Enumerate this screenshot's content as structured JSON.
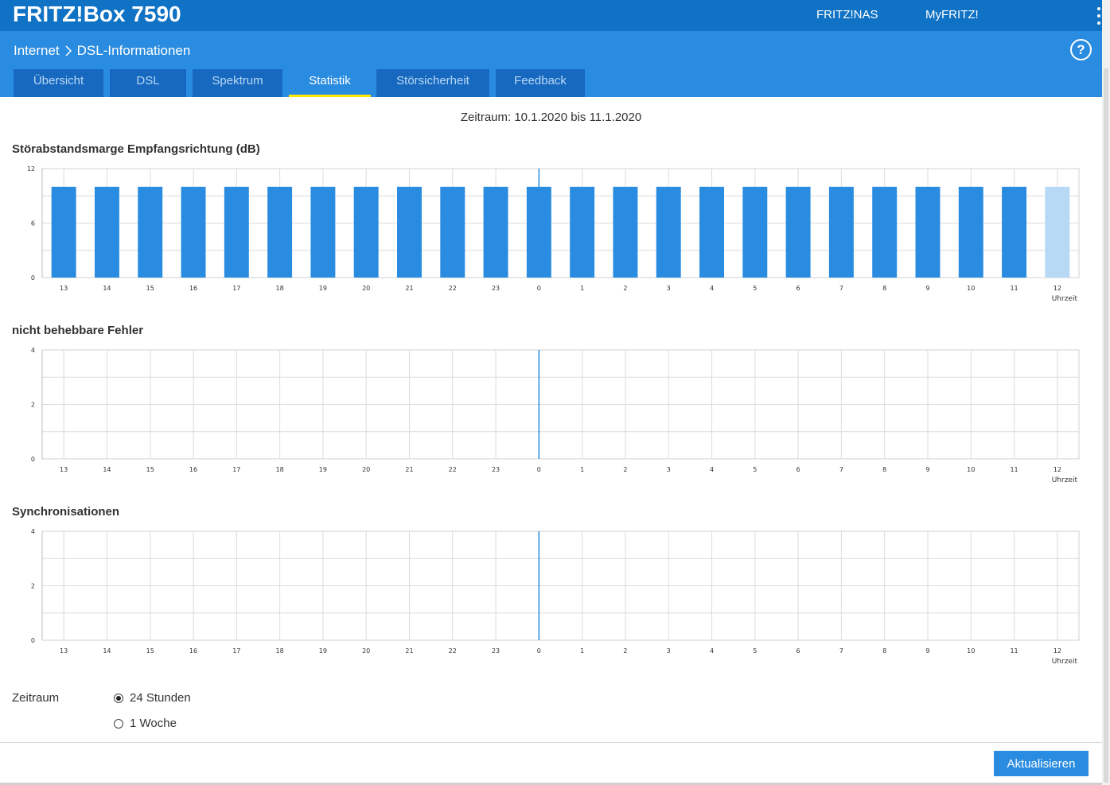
{
  "header": {
    "brand": "FRITZ!Box 7590",
    "links": [
      "FRITZ!NAS",
      "MyFRITZ!"
    ]
  },
  "breadcrumb": {
    "parent": "Internet",
    "separator": ">",
    "current": "DSL-Informationen"
  },
  "tabs": [
    {
      "label": "Übersicht",
      "active": false
    },
    {
      "label": "DSL",
      "active": false
    },
    {
      "label": "Spektrum",
      "active": false
    },
    {
      "label": "Statistik",
      "active": true
    },
    {
      "label": "Störsicherheit",
      "active": false
    },
    {
      "label": "Feedback",
      "active": false
    }
  ],
  "period_text": "Zeitraum: 10.1.2020 bis 11.1.2020",
  "colors": {
    "accent": "#2a8ce0",
    "header": "#0f72c4",
    "tab_inactive": "#1769c0",
    "tab_active_underline": "#ffe600",
    "bar": "#2a8ce0",
    "bar_current": "#b8d9f5"
  },
  "chart_data": [
    {
      "type": "bar",
      "title": "Störabstandsmarge Empfangsrichtung (dB)",
      "xlabel": "Uhrzeit",
      "categories": [
        "13",
        "14",
        "15",
        "16",
        "17",
        "18",
        "19",
        "20",
        "21",
        "22",
        "23",
        "0",
        "1",
        "2",
        "3",
        "4",
        "5",
        "6",
        "7",
        "8",
        "9",
        "10",
        "11",
        "12"
      ],
      "values": [
        10,
        10,
        10,
        10,
        10,
        10,
        10,
        10,
        10,
        10,
        10,
        10,
        10,
        10,
        10,
        10,
        10,
        10,
        10,
        10,
        10,
        10,
        10,
        10
      ],
      "partial_last": true,
      "ylim": [
        0,
        12
      ],
      "yticks": [
        0,
        6,
        12
      ],
      "midnight_marker": "0",
      "grid": true
    },
    {
      "type": "bar",
      "title": "nicht behebbare Fehler",
      "xlabel": "Uhrzeit",
      "categories": [
        "13",
        "14",
        "15",
        "16",
        "17",
        "18",
        "19",
        "20",
        "21",
        "22",
        "23",
        "0",
        "1",
        "2",
        "3",
        "4",
        "5",
        "6",
        "7",
        "8",
        "9",
        "10",
        "11",
        "12"
      ],
      "values": [
        0,
        0,
        0,
        0,
        0,
        0,
        0,
        0,
        0,
        0,
        0,
        0,
        0,
        0,
        0,
        0,
        0,
        0,
        0,
        0,
        0,
        0,
        0,
        0
      ],
      "ylim": [
        0,
        4
      ],
      "yticks": [
        0,
        2,
        4
      ],
      "midnight_marker": "0",
      "grid": true
    },
    {
      "type": "bar",
      "title": "Synchronisationen",
      "xlabel": "Uhrzeit",
      "categories": [
        "13",
        "14",
        "15",
        "16",
        "17",
        "18",
        "19",
        "20",
        "21",
        "22",
        "23",
        "0",
        "1",
        "2",
        "3",
        "4",
        "5",
        "6",
        "7",
        "8",
        "9",
        "10",
        "11",
        "12"
      ],
      "values": [
        0,
        0,
        0,
        0,
        0,
        0,
        0,
        0,
        0,
        0,
        0,
        0,
        0,
        0,
        0,
        0,
        0,
        0,
        0,
        0,
        0,
        0,
        0,
        0
      ],
      "ylim": [
        0,
        4
      ],
      "yticks": [
        0,
        2,
        4
      ],
      "midnight_marker": "0",
      "grid": true
    }
  ],
  "form": {
    "label": "Zeitraum",
    "options": [
      {
        "label": "24 Stunden",
        "checked": true
      },
      {
        "label": "1 Woche",
        "checked": false
      }
    ],
    "submit_label": "Aktualisieren"
  }
}
